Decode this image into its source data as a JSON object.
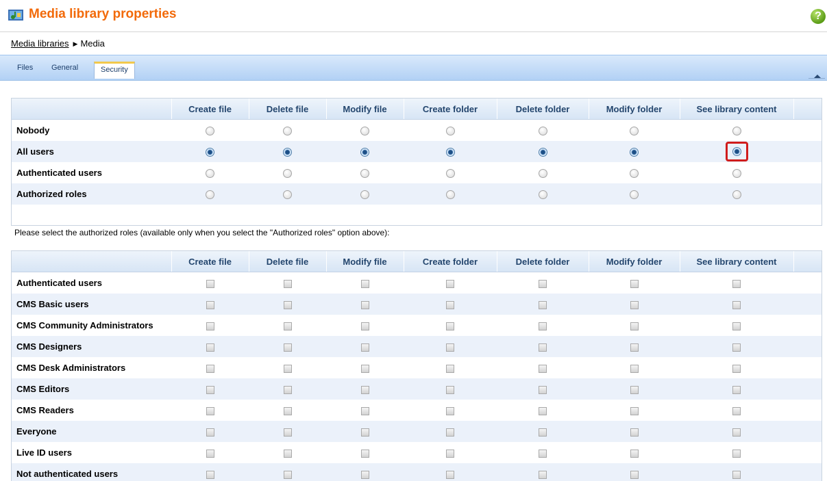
{
  "header": {
    "title": "Media library properties",
    "help_label": "?"
  },
  "breadcrumb": {
    "parent": "Media libraries",
    "separator": "▶",
    "current": "Media"
  },
  "tabs": [
    {
      "label": "Files",
      "active": false
    },
    {
      "label": "General",
      "active": false
    },
    {
      "label": "Security",
      "active": true
    }
  ],
  "columns": [
    "Create file",
    "Delete file",
    "Modify file",
    "Create folder",
    "Delete folder",
    "Modify folder",
    "See library content"
  ],
  "access_rows": [
    {
      "label": "Nobody",
      "selected": false
    },
    {
      "label": "All users",
      "selected": true
    },
    {
      "label": "Authenticated users",
      "selected": false
    },
    {
      "label": "Authorized roles",
      "selected": false
    }
  ],
  "note": "Please select the authorized roles (available only when you select the \"Authorized roles\" option above):",
  "roles": [
    "Authenticated users",
    "CMS Basic users",
    "CMS Community Administrators",
    "CMS Designers",
    "CMS Desk Administrators",
    "CMS Editors",
    "CMS Readers",
    "Everyone",
    "Live ID users",
    "Not authenticated users"
  ],
  "highlight": {
    "row": "All users",
    "column": "See library content",
    "color": "#d01c1c"
  },
  "colors": {
    "title": "#f26a0a",
    "tabbar": "#b2d1f5",
    "header_text": "#24466e",
    "alt_row": "#ebf1fa"
  }
}
